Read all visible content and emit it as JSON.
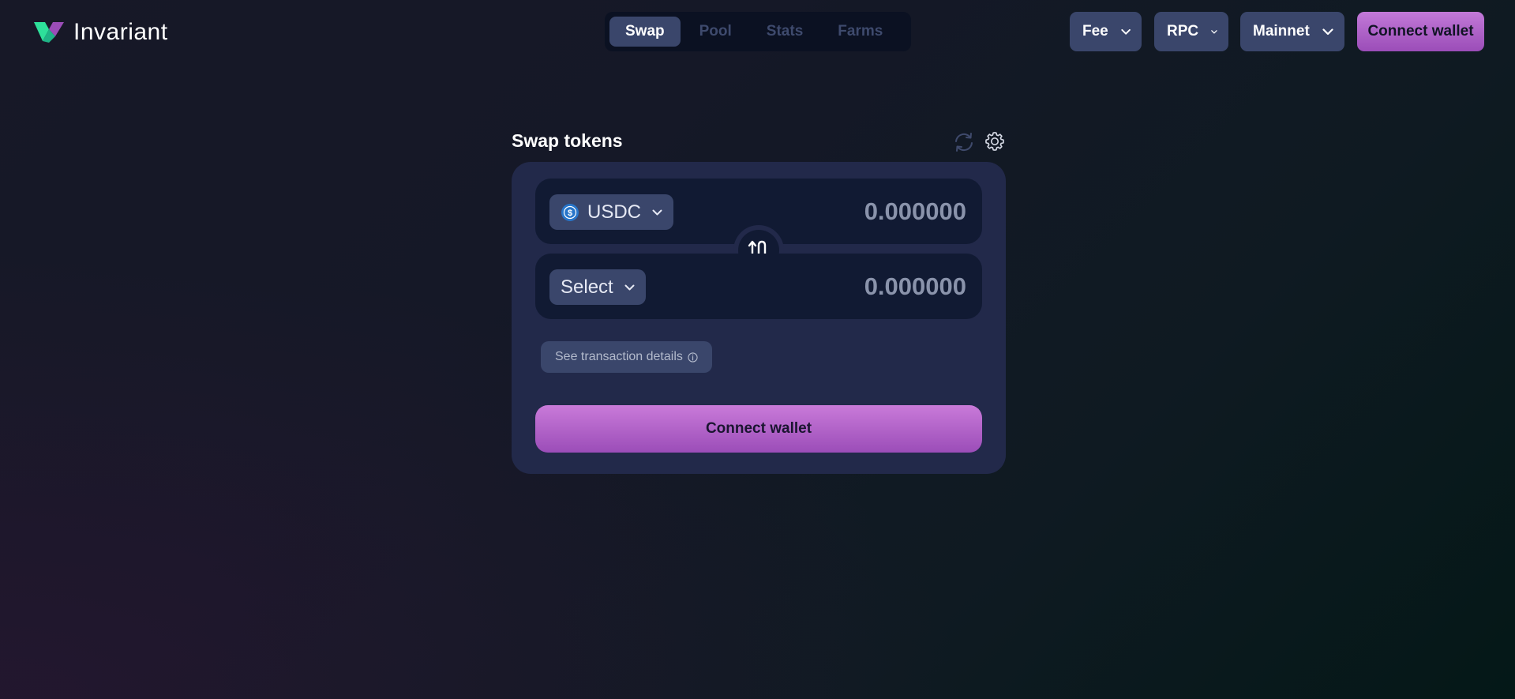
{
  "header": {
    "logo_text": "Invariant",
    "nav_tabs": [
      {
        "label": "Swap",
        "active": true
      },
      {
        "label": "Pool",
        "active": false
      },
      {
        "label": "Stats",
        "active": false
      },
      {
        "label": "Farms",
        "active": false
      }
    ],
    "fee_label": "Fee",
    "rpc_label": "RPC",
    "network_label": "Mainnet",
    "connect_wallet_label": "Connect wallet"
  },
  "swap": {
    "title": "Swap tokens",
    "from_token": {
      "symbol": "USDC",
      "icon": "usdc-icon",
      "amount_placeholder": "0.000000"
    },
    "to_token": {
      "symbol": "Select",
      "amount_placeholder": "0.000000"
    },
    "details_label": "See transaction details",
    "connect_wallet_label": "Connect wallet"
  },
  "colors": {
    "accent_purple": "#b765d2",
    "tab_active_bg": "#3a466b",
    "card_bg": "#22294a",
    "logo_green": "#2ee09a",
    "logo_purple": "#9b4db8"
  },
  "icons": [
    "chevron-down-icon",
    "refresh-icon",
    "settings-icon",
    "swap-arrows-icon",
    "info-icon",
    "usdc-icon"
  ]
}
